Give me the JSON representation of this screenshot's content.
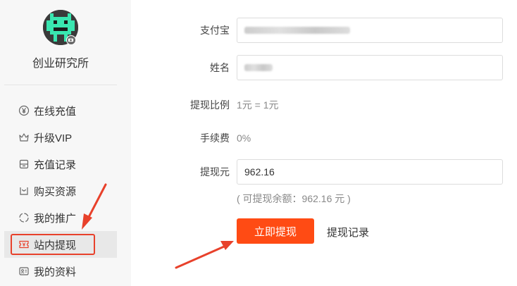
{
  "sidebar": {
    "username": "创业研究所",
    "items": [
      {
        "label": "在线充值",
        "icon": "yen-circle-icon"
      },
      {
        "label": "升级VIP",
        "icon": "crown-icon"
      },
      {
        "label": "充值记录",
        "icon": "archive-box-icon"
      },
      {
        "label": "购买资源",
        "icon": "bag-icon"
      },
      {
        "label": "我的推广",
        "icon": "share-circle-icon"
      },
      {
        "label": "站内提现",
        "icon": "withdraw-ticket-icon",
        "active": true
      },
      {
        "label": "我的资料",
        "icon": "id-card-icon"
      }
    ]
  },
  "form": {
    "alipay_label": "支付宝",
    "name_label": "姓名",
    "ratio_label": "提现比例",
    "ratio_value": "1元 = 1元",
    "fee_label": "手续费",
    "fee_value": "0%",
    "amount_label": "提现元",
    "amount_value": "962.16",
    "balance_hint": "( 可提现余额：962.16 元 )",
    "submit_label": "立即提现",
    "record_label": "提现记录"
  },
  "colors": {
    "accent": "#ff4b14",
    "highlight": "#e8412b"
  }
}
